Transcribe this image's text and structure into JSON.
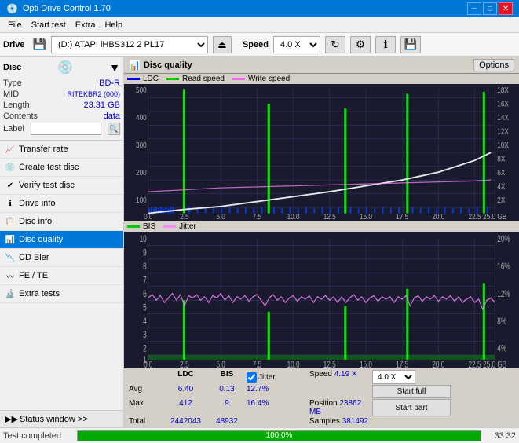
{
  "titleBar": {
    "title": "Opti Drive Control 1.70",
    "minimize": "─",
    "maximize": "□",
    "close": "✕"
  },
  "menuBar": {
    "items": [
      "File",
      "Start test",
      "Extra",
      "Help"
    ]
  },
  "driveBar": {
    "label": "Drive",
    "driveValue": "(D:) ATAPI iHBS312  2 PL17",
    "speedLabel": "Speed",
    "speedValue": "4.0 X"
  },
  "discSection": {
    "title": "Disc",
    "typeLabel": "Type",
    "typeValue": "BD-R",
    "midLabel": "MID",
    "midValue": "RITEKBR2 (000)",
    "lengthLabel": "Length",
    "lengthValue": "23.31 GB",
    "contentsLabel": "Contents",
    "contentsValue": "data",
    "labelLabel": "Label"
  },
  "navItems": [
    {
      "id": "transfer-rate",
      "label": "Transfer rate"
    },
    {
      "id": "create-test-disc",
      "label": "Create test disc"
    },
    {
      "id": "verify-test-disc",
      "label": "Verify test disc"
    },
    {
      "id": "drive-info",
      "label": "Drive info"
    },
    {
      "id": "disc-info",
      "label": "Disc info"
    },
    {
      "id": "disc-quality",
      "label": "Disc quality",
      "active": true
    },
    {
      "id": "cd-bler",
      "label": "CD Bler"
    },
    {
      "id": "fe-te",
      "label": "FE / TE"
    },
    {
      "id": "extra-tests",
      "label": "Extra tests"
    }
  ],
  "statusWindow": "Status window >>",
  "qualityPanel": {
    "title": "Disc quality",
    "optionsBtn": "Options",
    "legend1": {
      "ldc": "LDC",
      "readSpeed": "Read speed",
      "writeSpeed": "Write speed"
    },
    "legend2": {
      "bis": "BIS",
      "jitter": "Jitter"
    },
    "topAxisLabels": [
      "18X",
      "16X",
      "14X",
      "12X",
      "10X",
      "8X",
      "6X",
      "4X",
      "2X"
    ],
    "bottomAxisLabels": [
      "20%",
      "16%",
      "12%",
      "8%",
      "4%"
    ],
    "xLabels": [
      "0.0",
      "2.5",
      "5.0",
      "7.5",
      "10.0",
      "12.5",
      "15.0",
      "17.5",
      "20.0",
      "22.5",
      "25.0 GB"
    ]
  },
  "stats": {
    "headers": [
      "",
      "LDC",
      "BIS",
      "",
      "Jitter",
      "Speed",
      ""
    ],
    "avgLabel": "Avg",
    "avgLDC": "6.40",
    "avgBIS": "0.13",
    "avgJitter": "12.7%",
    "speedVal": "4.19 X",
    "speedSelect": "4.0 X",
    "maxLabel": "Max",
    "maxLDC": "412",
    "maxBIS": "9",
    "maxJitter": "16.4%",
    "positionLabel": "Position",
    "positionValue": "23862 MB",
    "totalLabel": "Total",
    "totalLDC": "2442043",
    "totalBIS": "48932",
    "samplesLabel": "Samples",
    "samplesValue": "381492",
    "startFullBtn": "Start full",
    "startPartBtn": "Start part",
    "jitterLabel": "Jitter",
    "jitterChecked": true
  },
  "progressBar": {
    "statusText": "Test completed",
    "percent": 100,
    "percentLabel": "100.0%",
    "time": "33:32"
  }
}
